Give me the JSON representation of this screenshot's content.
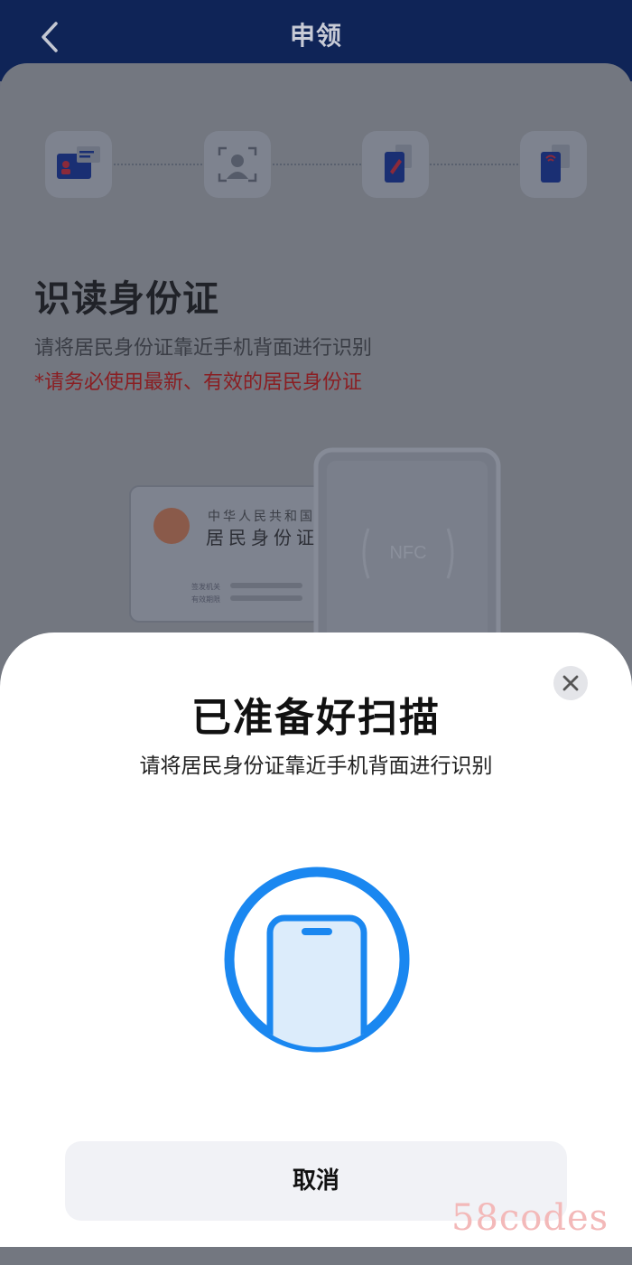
{
  "header": {
    "title": "申领"
  },
  "steps": [
    {
      "icon": "id-card-icon"
    },
    {
      "icon": "face-scan-icon"
    },
    {
      "icon": "phone-edit-icon"
    },
    {
      "icon": "phone-nfc-icon"
    }
  ],
  "main": {
    "title": "识读身份证",
    "instruction": "请将居民身份证靠近手机背面进行识别",
    "warning": "*请务必使用最新、有效的居民身份证"
  },
  "illustration": {
    "card_line1": "中华人民共和国",
    "card_line2": "居民身份证",
    "field1": "签发机关",
    "field2": "有效期限",
    "nfc_label": "NFC"
  },
  "sheet": {
    "title": "已准备好扫描",
    "subtitle": "请将居民身份证靠近手机背面进行识别",
    "cancel_label": "取消"
  },
  "watermark": "58codes",
  "colors": {
    "accent": "#1a87f0",
    "header_bg": "#0f2457",
    "warning": "#8a1e22"
  }
}
